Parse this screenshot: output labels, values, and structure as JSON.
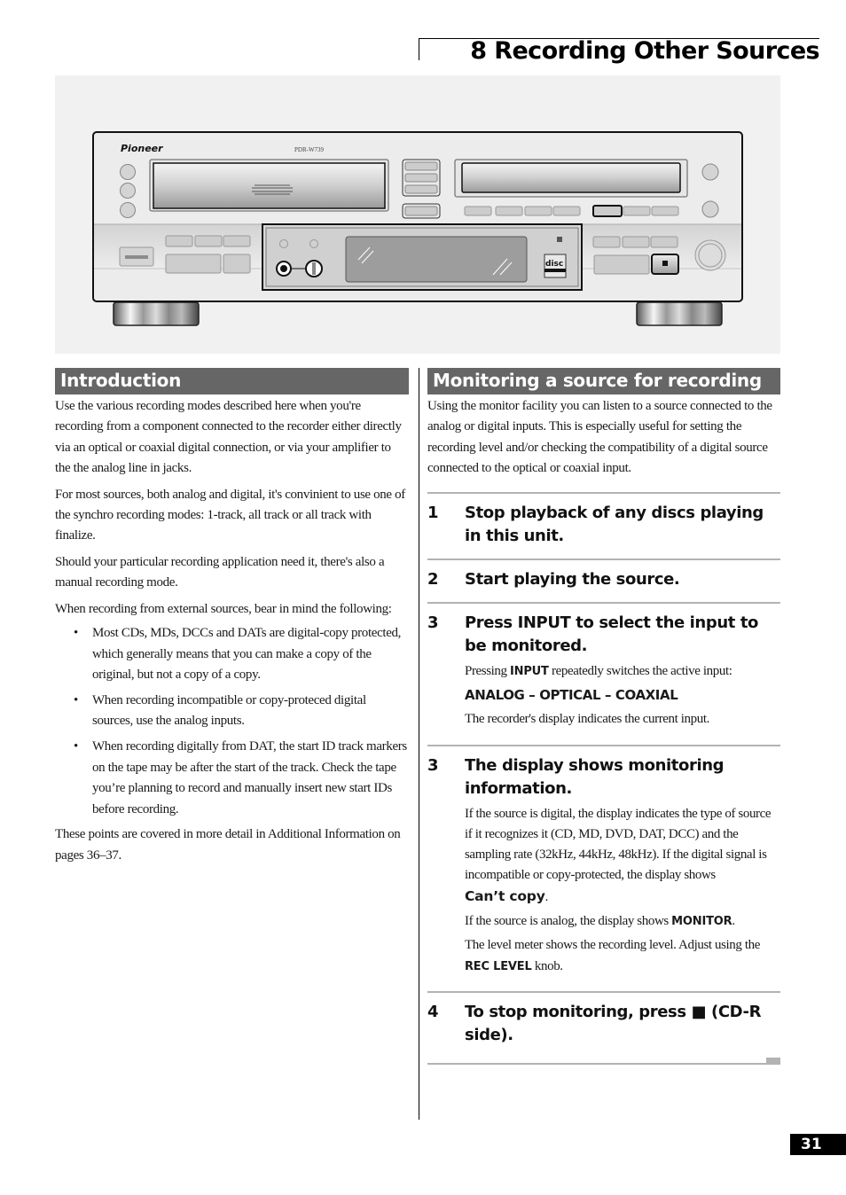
{
  "header": {
    "chapter_title": "8 Recording Other Sources"
  },
  "illustration": {
    "brand": "Pioneer",
    "model": "PDR-W739",
    "description": "Front panel of CD recorder"
  },
  "introduction": {
    "title": "Introduction",
    "paragraphs": [
      "Use the various recording modes described here when you're recording from a component connected to the recorder either directly via an optical or coaxial digital connection, or via your amplifier to the the analog line in jacks.",
      "For most sources, both analog and digital, it's convinient to use one of the synchro recording modes: 1-track, all track or all track with finalize.",
      "Should your particular recording application need it, there's also a manual recording mode.",
      "When recording from external sources, bear in mind the following:"
    ],
    "bullets": [
      "Most CDs, MDs, DCCs and DATs are digital-copy protected, which generally means that you can make a copy of the original, but not a copy of a copy.",
      "When recording incompatible or copy-proteced digital sources, use the analog inputs.",
      "When recording digitally from DAT, the start ID track markers on the tape may be after the start of the track. Check the tape you’re planning to record and manually insert new start IDs before recording."
    ],
    "bullet_char": "•",
    "closing": "These points are covered in more detail in Additional Information on pages 36–37."
  },
  "monitoring": {
    "title": "Monitoring a source for recording",
    "intro": "Using the monitor facility you can listen to a source connected to the analog or digital inputs. This is especially useful  for setting the recording level and/or checking the compatibility of a digital source connected to the optical or coaxial input.",
    "steps": [
      {
        "num": "1",
        "heading": "Stop playback of any discs playing in this unit."
      },
      {
        "num": "2",
        "heading": "Start playing the source."
      },
      {
        "num": "3",
        "heading": "Press INPUT to select the input to be monitored.",
        "body": {
          "p1_pre": "Pressing ",
          "p1_key": "INPUT",
          "p1_post": " repeatedly switches the active input:",
          "inputs_sequence": "ANALOG – OPTICAL – COAXIAL",
          "p3": "The recorder's display indicates the current input."
        }
      },
      {
        "num": "3",
        "heading": "The display shows monitoring information.",
        "body": {
          "p1": "If the source is digital, the display indicates the type of source if it recognizes it (CD, MD, DVD, DAT, DCC) and the sampling rate (32kHz, 44kHz, 48kHz). If the digital signal is incompatible or copy-protected, the display shows",
          "p1_display": "Can’t copy",
          "p1_end": ".",
          "p2_pre": "If the source is analog, the display shows ",
          "p2_key": "MONITOR",
          "p2_post": ".",
          "p3_pre": "The level meter shows the recording level. Adjust using the ",
          "p3_key": "REC LEVEL",
          "p3_post": " knob."
        }
      },
      {
        "num": "4",
        "heading": "To stop monitoring, press ■ (CD-R side)."
      }
    ]
  },
  "footer": {
    "page_number": "31"
  }
}
